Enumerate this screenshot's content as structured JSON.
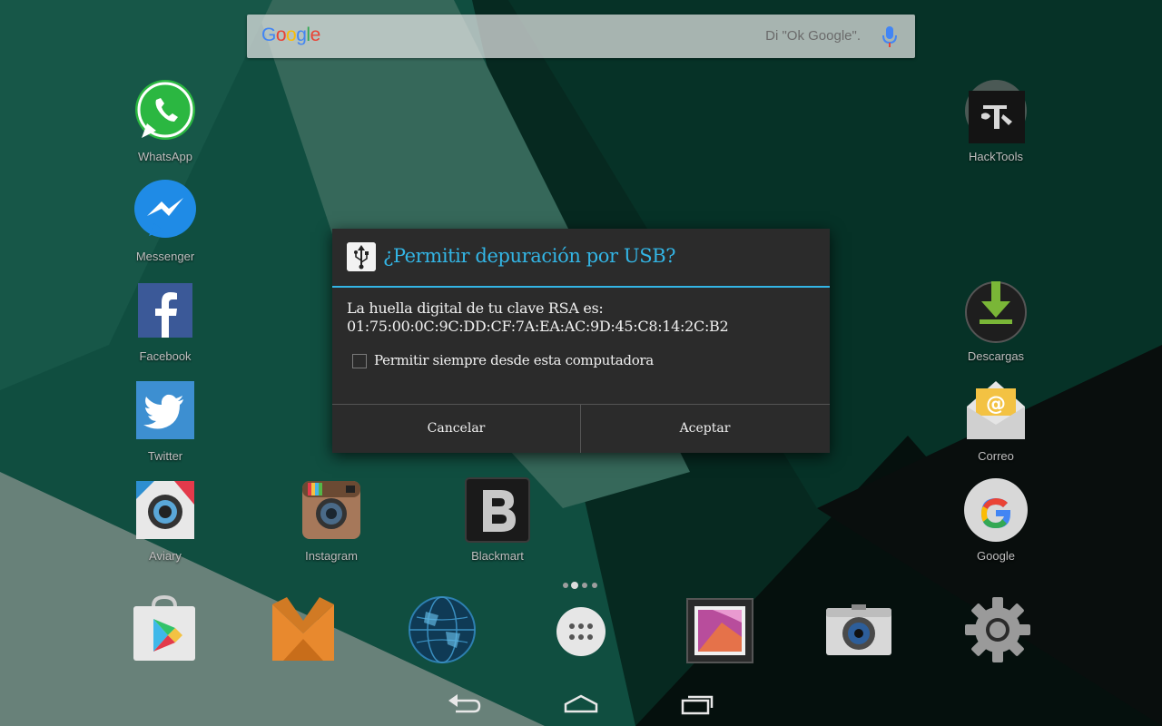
{
  "search": {
    "logo_letters": [
      {
        "ch": "G",
        "color": "#4285f4"
      },
      {
        "ch": "o",
        "color": "#ea4335"
      },
      {
        "ch": "o",
        "color": "#fbbc05"
      },
      {
        "ch": "g",
        "color": "#4285f4"
      },
      {
        "ch": "l",
        "color": "#34a853"
      },
      {
        "ch": "e",
        "color": "#ea4335"
      }
    ],
    "hint": "Di \"Ok Google\"."
  },
  "apps": {
    "whatsapp": "WhatsApp",
    "messenger": "Messenger",
    "facebook": "Facebook",
    "twitter": "Twitter",
    "aviary": "Aviary",
    "instagram": "Instagram",
    "blackmart": "Blackmart",
    "hacktools": "HackTools",
    "descargas": "Descargas",
    "correo": "Correo",
    "google": "Google"
  },
  "dock": [
    "play-store-icon",
    "aptoide-icon",
    "globe-icon",
    "app-drawer-icon",
    "gallery-icon",
    "camera-icon",
    "settings-icon"
  ],
  "dialog": {
    "title": "¿Permitir depuración por USB?",
    "message_line1": "La huella digital de tu clave RSA es:",
    "message_line2": "01:75:00:0C:9C:DD:CF:7A:EA:AC:9D:45:C8:14:2C:B2",
    "checkbox_label": "Permitir siempre desde esta computadora",
    "checkbox_checked": false,
    "cancel_label": "Cancelar",
    "accept_label": "Aceptar",
    "accent_color": "#33b5e5"
  },
  "nav": [
    "back-icon",
    "home-icon",
    "recents-icon"
  ]
}
